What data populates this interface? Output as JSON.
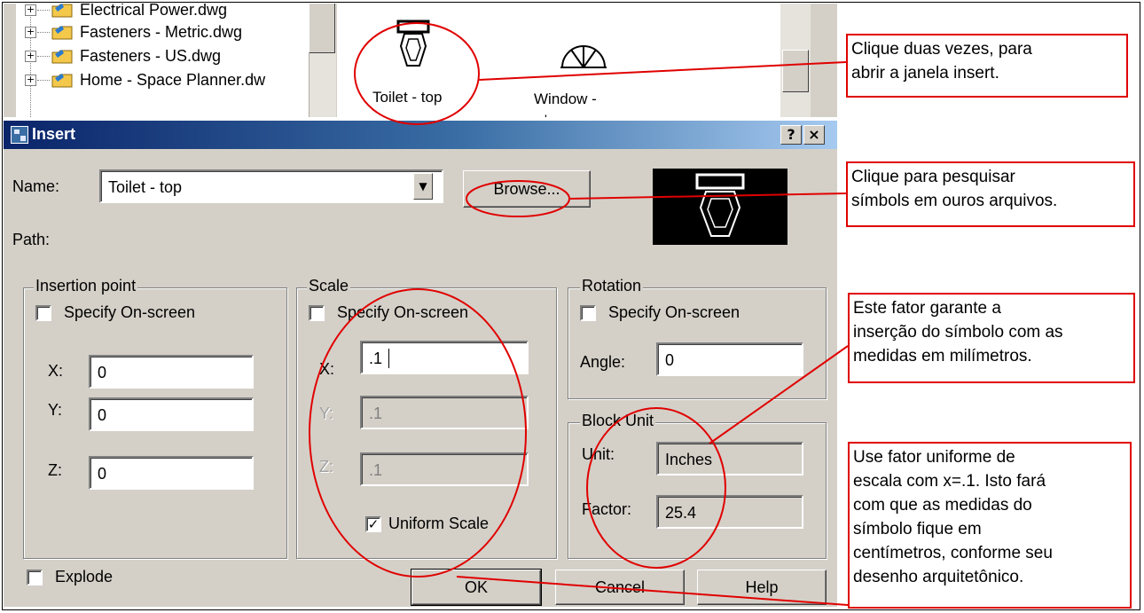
{
  "design_center": {
    "tree_items": [
      {
        "label": "Electrical Power.dwg"
      },
      {
        "label": "Fasteners - Metric.dwg"
      },
      {
        "label": "Fasteners - US.dwg"
      },
      {
        "label": "Home - Space Planner.dw"
      }
    ],
    "palette_items": [
      {
        "label": "Toilet - top"
      },
      {
        "label": "Window -"
      }
    ]
  },
  "dialog": {
    "title": "Insert",
    "help_title_button": "?",
    "close_title_button": "×",
    "name_label": "Name:",
    "name_value": "Toilet - top",
    "browse_label": "Browse...",
    "path_label": "Path:",
    "insertion_point": {
      "title": "Insertion point",
      "specify_label": "Specify On-screen",
      "specify_checked": false,
      "x_label": "X:",
      "x_value": "0",
      "y_label": "Y:",
      "y_value": "0",
      "z_label": "Z:",
      "z_value": "0"
    },
    "scale": {
      "title": "Scale",
      "specify_label": "Specify On-screen",
      "specify_checked": false,
      "x_label": "X:",
      "x_value": ".1",
      "y_label": "Y:",
      "y_value": ".1",
      "z_label": "Z:",
      "z_value": ".1",
      "uniform_label": "Uniform Scale",
      "uniform_checked": true
    },
    "rotation": {
      "title": "Rotation",
      "specify_label": "Specify On-screen",
      "specify_checked": false,
      "angle_label": "Angle:",
      "angle_value": "0"
    },
    "block_unit": {
      "title": "Block Unit",
      "unit_label": "Unit:",
      "unit_value": "Inches",
      "factor_label": "Factor:",
      "factor_value": "25.4"
    },
    "explode_label": "Explode",
    "explode_checked": false,
    "ok_label": "OK",
    "cancel_label": "Cancel",
    "help_label": "Help"
  },
  "callouts": {
    "double_click": [
      "Clique duas vezes, para",
      "abrir a janela insert."
    ],
    "browse": [
      "Clique para pesquisar",
      "símbols em ouros arquivos."
    ],
    "factor": [
      "Este fator garante a",
      "inserção do símbolo com as",
      "medidas em milímetros."
    ],
    "uniform": [
      "Use fator uniforme de",
      "escala com x=.1. Isto fará",
      "com que as medidas do",
      "símbolo fique em",
      "centímetros, conforme seu",
      "desenho arquitetônico."
    ]
  },
  "colors": {
    "annotation": "#e00000",
    "titlebar_start": "#0a246a",
    "dialog_bg": "#d4d0c8"
  }
}
